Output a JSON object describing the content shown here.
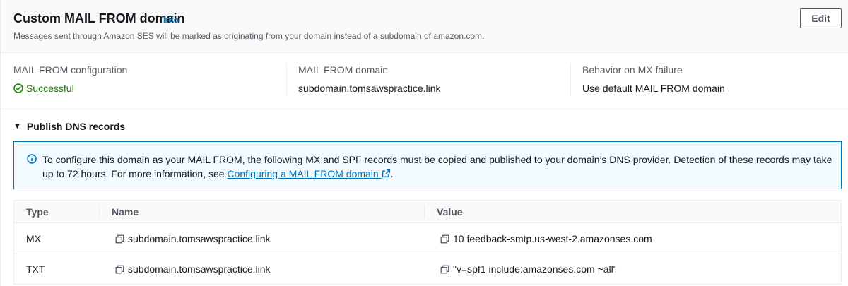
{
  "header": {
    "title": "Custom MAIL FROM domain",
    "info": "Info",
    "subtitle": "Messages sent through Amazon SES will be marked as originating from your domain instead of a subdomain of amazon.com.",
    "edit_label": "Edit"
  },
  "details": [
    {
      "label": "MAIL FROM configuration",
      "value": "Successful",
      "status": "success"
    },
    {
      "label": "MAIL FROM domain",
      "value": "subdomain.tomsawspractice.link"
    },
    {
      "label": "Behavior on MX failure",
      "value": "Use default MAIL FROM domain"
    }
  ],
  "dns_section": {
    "title": "Publish DNS records",
    "alert_text": "To configure this domain as your MAIL FROM, the following MX and SPF records must be copied and published to your domain’s DNS provider. Detection of these records may take up to 72 hours. For more information, see ",
    "alert_link": "Configuring a MAIL FROM domain",
    "alert_end": "."
  },
  "table": {
    "columns": [
      "Type",
      "Name",
      "Value"
    ],
    "rows": [
      {
        "type": "MX",
        "name": "subdomain.tomsawspractice.link",
        "value": "10 feedback-smtp.us-west-2.amazonses.com"
      },
      {
        "type": "TXT",
        "name": "subdomain.tomsawspractice.link",
        "value": "\"v=spf1 include:amazonses.com ~all\""
      }
    ]
  },
  "colors": {
    "link": "#0073bb",
    "success": "#1d8102",
    "alert_bg": "#f1faff"
  },
  "icons": [
    "check-circle-icon",
    "info-circle-icon",
    "external-link-icon",
    "copy-icon",
    "caret-down-icon"
  ]
}
